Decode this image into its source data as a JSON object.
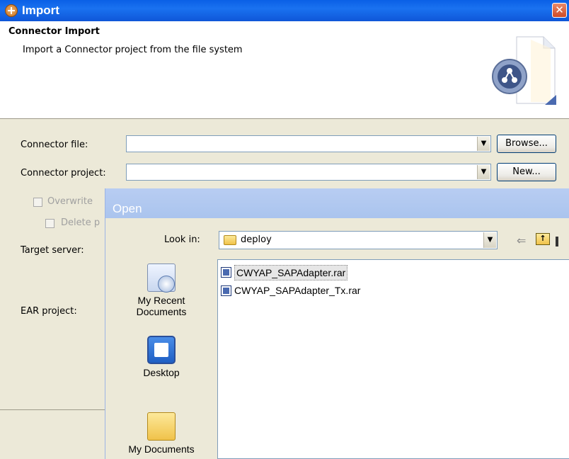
{
  "import_window": {
    "title": "Import",
    "close_glyph": "✕",
    "banner": {
      "title": "Connector Import",
      "description": "Import a Connector project from the file system"
    },
    "connector_file": {
      "label": "Connector file:",
      "value": "",
      "button": "Browse..."
    },
    "connector_project": {
      "label": "Connector project:",
      "value": "",
      "button": "New..."
    },
    "overwrite_label": "Overwrite",
    "delete_label": "Delete p",
    "target_server_label": "Target server:",
    "ear_project_label": "EAR project:"
  },
  "open_dialog": {
    "title": "Open",
    "look_in_label": "Look in:",
    "look_in_value": "deploy",
    "back_glyph": "⇐",
    "up_glyph": "↑",
    "places": [
      {
        "label": "My Recent Documents",
        "icon": "recent-documents-icon"
      },
      {
        "label": "Desktop",
        "icon": "desktop-icon"
      },
      {
        "label": "My Documents",
        "icon": "my-documents-icon"
      }
    ],
    "files": [
      {
        "name": "CWYAP_SAPAdapter.rar"
      },
      {
        "name": "CWYAP_SAPAdapter_Tx.rar"
      }
    ]
  }
}
